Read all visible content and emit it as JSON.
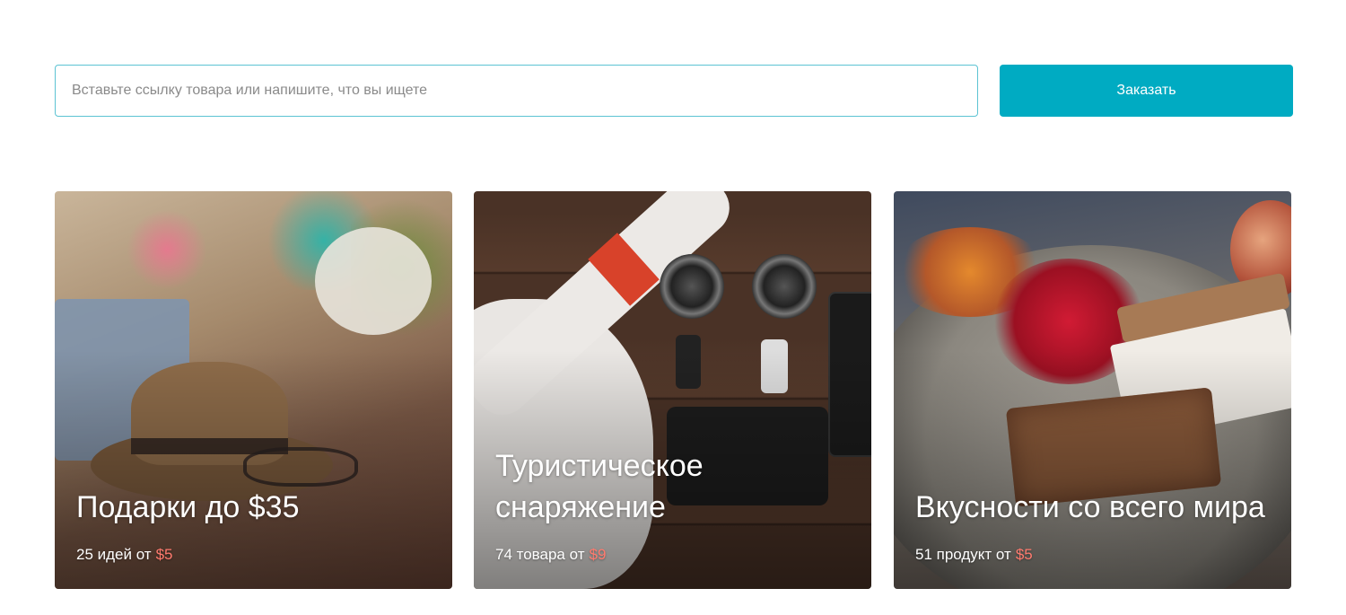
{
  "search": {
    "placeholder": "Вставьте ссылку товара или напишите, что вы ищете",
    "value": ""
  },
  "order_button": {
    "label": "Заказать"
  },
  "colors": {
    "accent": "#00abc2",
    "price": "#ff7a6e",
    "input_border": "#5cc3d3"
  },
  "cards": [
    {
      "title": "Подарки до $35",
      "count_text": "25 идей от",
      "price": "$5"
    },
    {
      "title": "Туристическое\nснаряжение",
      "count_text": "74 товара от",
      "price": "$9"
    },
    {
      "title": "Вкусности со всего мира",
      "count_text": "51 продукт от",
      "price": "$5"
    }
  ]
}
